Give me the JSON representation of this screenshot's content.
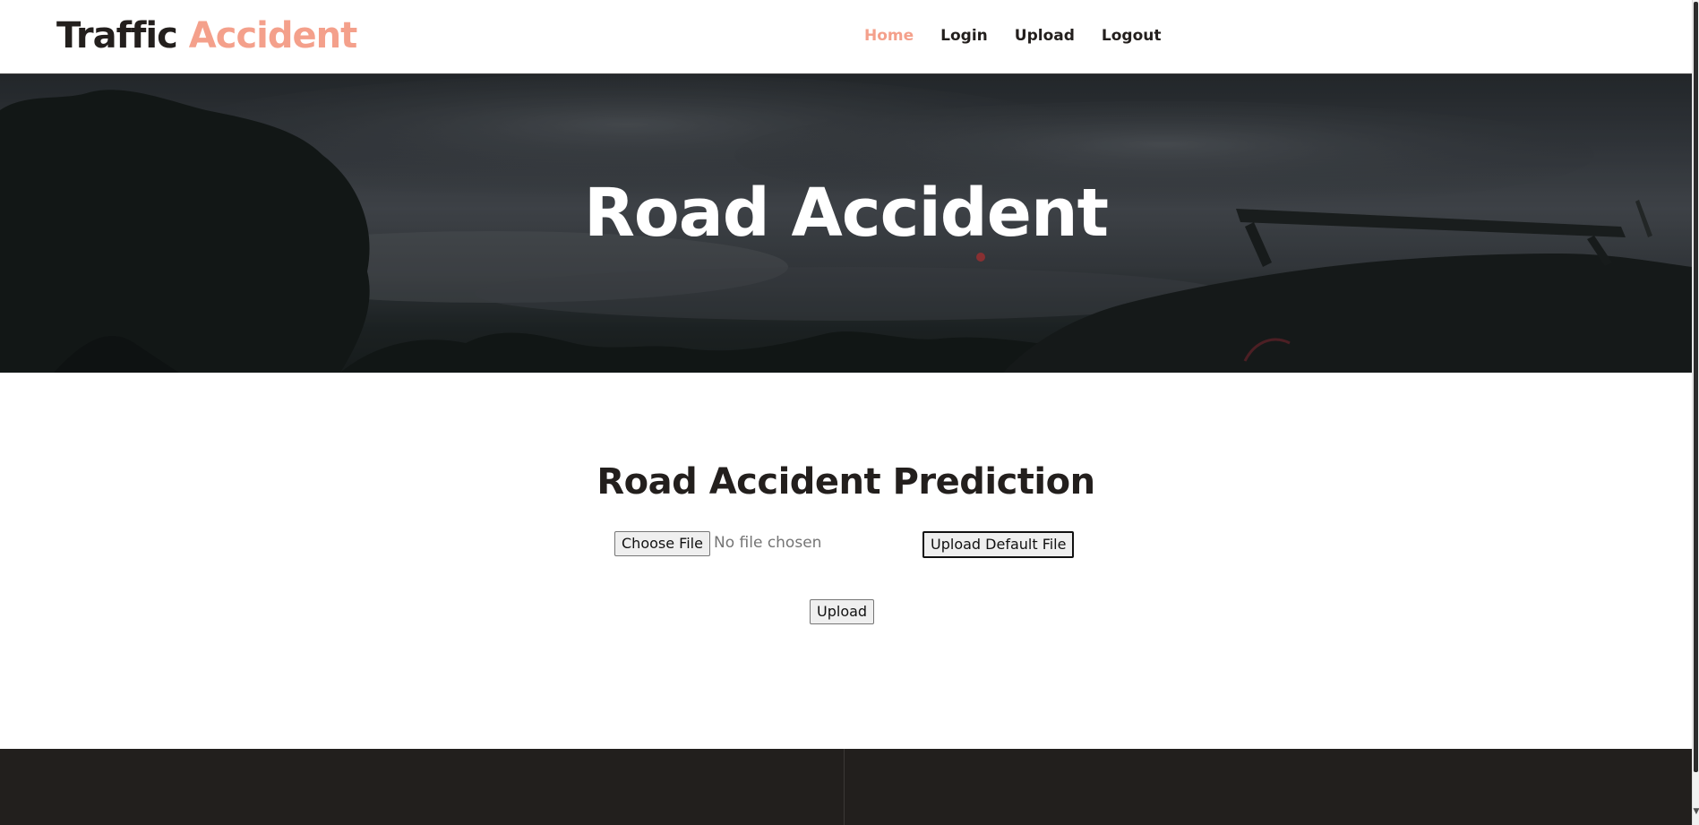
{
  "header": {
    "brand_part1": "Traffic",
    "brand_part2": "Accident",
    "nav": [
      {
        "label": "Home",
        "active": true
      },
      {
        "label": "Login",
        "active": false
      },
      {
        "label": "Upload",
        "active": false
      },
      {
        "label": "Logout",
        "active": false
      }
    ]
  },
  "hero": {
    "title": "Road Accident"
  },
  "main": {
    "title": "Road Accident Prediction",
    "choose_file_label": "Choose File",
    "no_file_text": "No file chosen",
    "upload_default_label": "Upload Default File",
    "upload_label": "Upload"
  },
  "colors": {
    "accent": "#f4a08b",
    "dark": "#231f1d",
    "footer": "#221f1d"
  }
}
